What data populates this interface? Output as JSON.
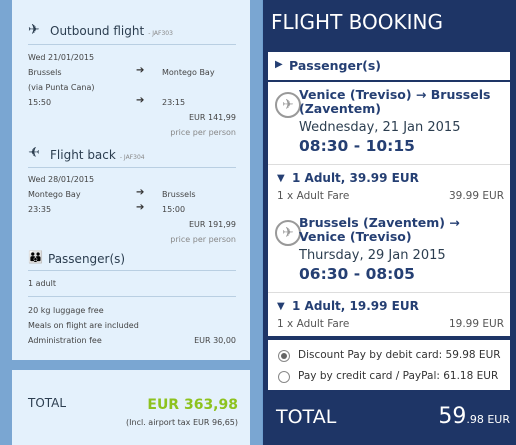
{
  "summary": {
    "outbound": {
      "title": "Outbound flight",
      "code": "- JAF303",
      "date": "Wed 21/01/2015",
      "from": "Brussels",
      "via": "(via Punta Cana)",
      "to": "Montego Bay",
      "dep": "15:50",
      "arr": "23:15",
      "price": "EUR 141,99",
      "price_note": "price per person"
    },
    "back": {
      "title": "Flight back",
      "code": "- JAF304",
      "date": "Wed 28/01/2015",
      "from": "Montego Bay",
      "to": "Brussels",
      "dep": "23:35",
      "arr": "15:00",
      "price": "EUR 191,99",
      "price_note": "price per person"
    },
    "passengers": {
      "title": "Passenger(s)",
      "count": "1 adult",
      "luggage": "20 kg luggage free",
      "meals": "Meals on flight are included",
      "admin_label": "Administration fee",
      "admin_fee": "EUR 30,00"
    },
    "total": {
      "label": "TOTAL",
      "amount": "EUR 363,98",
      "tax_note": "(Incl. airport tax EUR 96,65)"
    }
  },
  "booking": {
    "header": "FLIGHT BOOKING",
    "passengers_label": "Passenger(s)",
    "flight1": {
      "route": "Venice (Treviso) → Brussels (Zaventem)",
      "date": "Wednesday, 21 Jan 2015",
      "time": "08:30 - 10:15",
      "fare_title": "1 Adult, 39.99 EUR",
      "fare_label": "1 x Adult Fare",
      "fare_value": "39.99 EUR"
    },
    "flight2": {
      "route": "Brussels (Zaventem) → Venice (Treviso)",
      "date": "Thursday, 29 Jan 2015",
      "time": "06:30 - 08:05",
      "fare_title": "1 Adult, 19.99 EUR",
      "fare_label": "1 x Adult Fare",
      "fare_value": "19.99 EUR"
    },
    "payment": {
      "debit": "Discount Pay by debit card: 59.98 EUR",
      "credit": "Pay by credit card / PayPal: 61.18 EUR"
    },
    "total": {
      "label": "TOTAL",
      "amount_main": "59",
      "amount_dec": ".98 EUR"
    }
  },
  "colors": {
    "accent_green": "#8dc21f",
    "navy": "#1e3566"
  }
}
